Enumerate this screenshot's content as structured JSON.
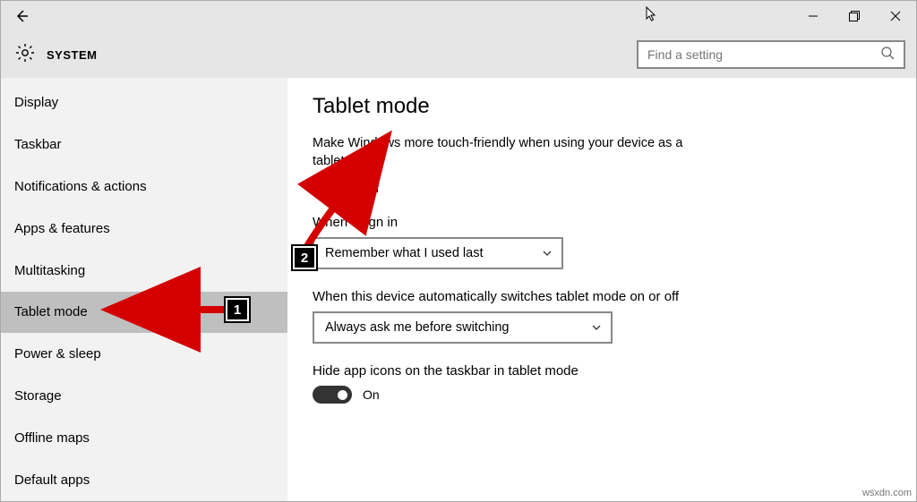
{
  "header": {
    "title": "SYSTEM"
  },
  "search": {
    "placeholder": "Find a setting"
  },
  "sidebar": {
    "items": [
      {
        "label": "Display"
      },
      {
        "label": "Taskbar"
      },
      {
        "label": "Notifications & actions"
      },
      {
        "label": "Apps & features"
      },
      {
        "label": "Multitasking"
      },
      {
        "label": "Tablet mode"
      },
      {
        "label": "Power & sleep"
      },
      {
        "label": "Storage"
      },
      {
        "label": "Offline maps"
      },
      {
        "label": "Default apps"
      }
    ],
    "selected_index": 5
  },
  "page": {
    "title": "Tablet mode",
    "touch_desc": "Make Windows more touch-friendly when using your device as a tablet",
    "touch_toggle_state": "Off",
    "signin_label": "When I sign in",
    "signin_value": "Remember what I used last",
    "autoswitch_label": "When this device automatically switches tablet mode on or off",
    "autoswitch_value": "Always ask me before switching",
    "hideicons_label": "Hide app icons on the taskbar in tablet mode",
    "hideicons_state": "On"
  },
  "annotations": {
    "step1": "1",
    "step2": "2"
  },
  "watermark": "wsxdn.com"
}
